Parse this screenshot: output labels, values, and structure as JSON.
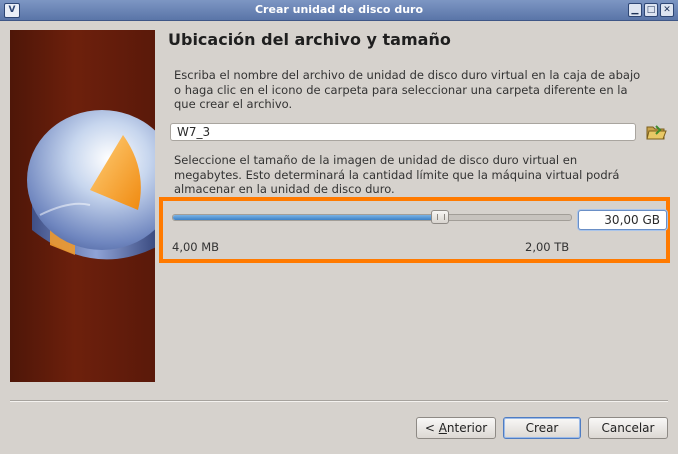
{
  "window": {
    "title": "Crear unidad de disco duro",
    "minimize_glyph": "▁",
    "maximize_glyph": "□",
    "close_glyph": "✕"
  },
  "main": {
    "heading": "Ubicación del archivo y tamaño",
    "location_description": "Escriba el nombre del archivo de unidad de disco duro virtual en la caja de abajo o haga clic en el icono de carpeta para seleccionar una carpeta diferente en la que crear el archivo.",
    "file_name_value": "W7_3",
    "size_description": "Seleccione el tamaño de la imagen de unidad de disco duro virtual en megabytes. Esto determinará la cantidad límite que la máquina virtual podrá almacenar en la unidad de disco duro.",
    "size_value": "30,00 GB",
    "size_slider_fraction": 0.67,
    "min_label": "4,00 MB",
    "max_label": "2,00 TB"
  },
  "buttons": {
    "back_prefix": "< ",
    "back_mnemonic": "A",
    "back_rest": "nterior",
    "create": "Crear",
    "cancel": "Cancelar"
  },
  "icons": {
    "app": "virtualbox-icon",
    "folder": "folder-open-icon"
  },
  "colors": {
    "highlight": "#ff7a00",
    "titlebar": "#6880b4",
    "slider_fill": "#3d82c8"
  }
}
